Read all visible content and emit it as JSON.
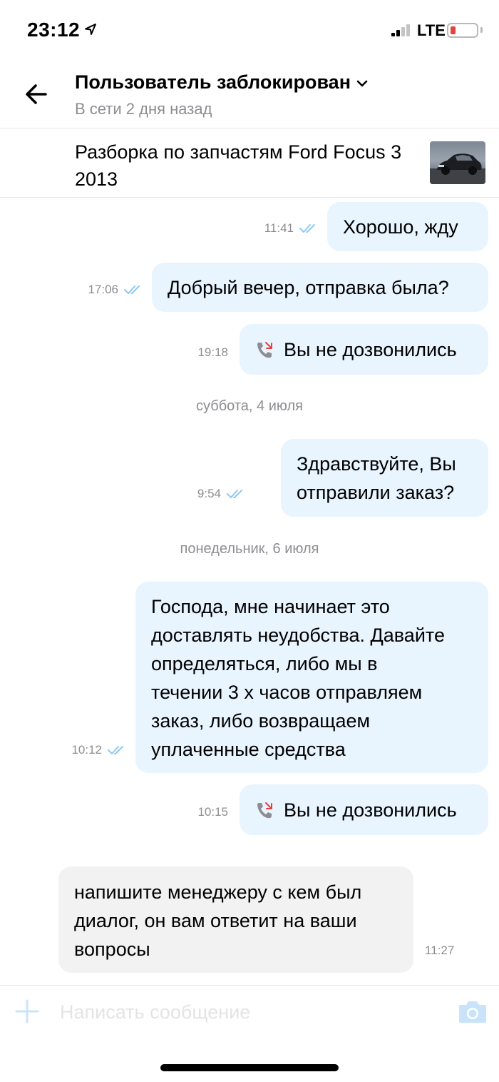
{
  "status_bar": {
    "time": "23:12",
    "network": "LTE",
    "battery_level": 0.2,
    "battery_color": "#e8403c"
  },
  "header": {
    "title": "Пользователь заблокирован",
    "subtitle": "В сети 2 дня назад",
    "back_icon": "arrow-left-icon",
    "title_dropdown_icon": "chevron-down-icon"
  },
  "listing": {
    "title": "Разборка по запчастям Ford Focus 3 2013",
    "thumbnail": "car-photo"
  },
  "colors": {
    "outgoing_bubble": "#e8f4fe",
    "incoming_bubble": "#f2f2f2",
    "read_ticks": "#8dc9f5",
    "muted_text": "#8d8d92",
    "accent_icons": "#c9e4fa"
  },
  "messages": [
    {
      "direction": "out",
      "type": "text",
      "lines": [
        "Хорошо, жду"
      ],
      "time": "11:41",
      "read": true
    },
    {
      "direction": "out",
      "type": "text",
      "lines": [
        "Добрый вечер, отправка была?"
      ],
      "time": "17:06",
      "read": true
    },
    {
      "direction": "out",
      "type": "call",
      "lines": [
        "Вы не дозвонились"
      ],
      "time": "19:18"
    },
    {
      "type": "date",
      "text": "суббота, 4 июля"
    },
    {
      "direction": "out",
      "type": "text",
      "lines": [
        "Здравствуйте, Вы",
        "отправили заказ?"
      ],
      "time": "9:54",
      "read": true
    },
    {
      "type": "date",
      "text": "понедельник, 6 июля"
    },
    {
      "direction": "out",
      "type": "text",
      "lines": [
        "Господа, мне начинает это",
        "доставлять неудобства. Давайте",
        "определяться, либо мы в",
        "течении 3 х часов отправляем",
        "заказ, либо возвращаем",
        "уплаченные средства"
      ],
      "time": "10:12",
      "read": true
    },
    {
      "direction": "out",
      "type": "call",
      "lines": [
        "Вы не дозвонились"
      ],
      "time": "10:15"
    },
    {
      "direction": "in",
      "type": "text",
      "lines": [
        "напишите менеджеру с кем был",
        "диалог, он вам ответит на ваши",
        "вопросы"
      ],
      "time": "11:27"
    }
  ],
  "composer": {
    "placeholder": "Написать сообщение",
    "value": "",
    "attach_icon": "plus-icon",
    "camera_icon": "camera-icon"
  }
}
